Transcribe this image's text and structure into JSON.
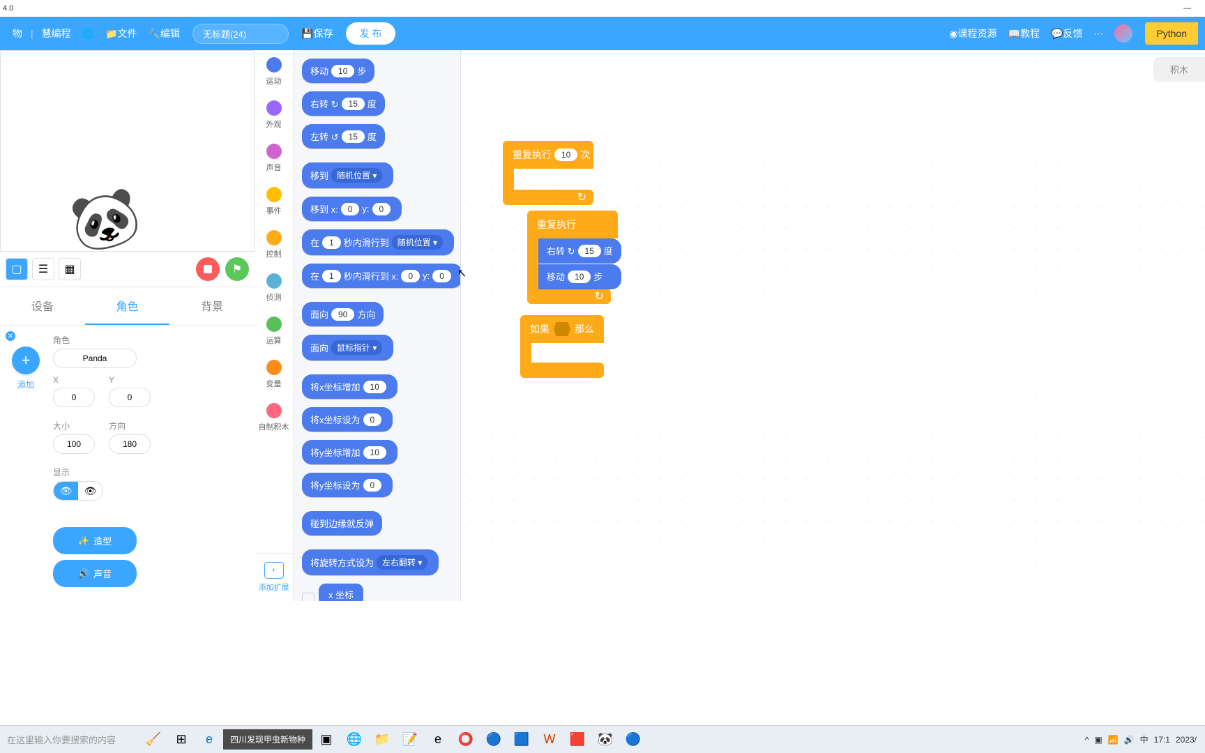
{
  "titlebar": {
    "version": "4.0"
  },
  "topbar": {
    "menu1": "物",
    "menu2": "慧编程",
    "file": "文件",
    "edit": "编辑",
    "project_name": "无标题(24)",
    "save": "保存",
    "publish": "发 布",
    "course": "课程资源",
    "tutorial": "教程",
    "feedback": "反馈",
    "python": "Python"
  },
  "stage_tabs": {
    "device": "设备",
    "sprite": "角色",
    "background": "背景"
  },
  "add": {
    "label": "添加"
  },
  "props": {
    "name_label": "角色",
    "name_value": "Panda",
    "x_label": "X",
    "x_value": "0",
    "y_label": "Y",
    "y_value": "0",
    "size_label": "大小",
    "size_value": "100",
    "dir_label": "方向",
    "dir_value": "180",
    "show_label": "显示",
    "costume_btn": "造型",
    "sound_btn": "声音"
  },
  "categories": [
    {
      "label": "运动",
      "color": "#4b7bec"
    },
    {
      "label": "外观",
      "color": "#9966ff"
    },
    {
      "label": "声音",
      "color": "#cf63cf"
    },
    {
      "label": "事件",
      "color": "#ffbf00"
    },
    {
      "label": "控制",
      "color": "#ffab19"
    },
    {
      "label": "侦测",
      "color": "#5cb1d6"
    },
    {
      "label": "运算",
      "color": "#59c059"
    },
    {
      "label": "变量",
      "color": "#ff8c1a"
    },
    {
      "label": "自制积木",
      "color": "#ff6680"
    }
  ],
  "ext": {
    "label": "添加扩展"
  },
  "blocks": {
    "move": {
      "t1": "移动",
      "v": "10",
      "t2": "步"
    },
    "turn_r": {
      "t1": "右转 ↻",
      "v": "15",
      "t2": "度"
    },
    "turn_l": {
      "t1": "左转 ↺",
      "v": "15",
      "t2": "度"
    },
    "goto_random": {
      "t1": "移到",
      "dd": "随机位置 ▾"
    },
    "goto_xy": {
      "t1": "移到 x:",
      "v1": "0",
      "t2": "y:",
      "v2": "0"
    },
    "glide_random": {
      "t1": "在",
      "v": "1",
      "t2": "秒内滑行到",
      "dd": "随机位置 ▾"
    },
    "glide_xy": {
      "t1": "在",
      "v": "1",
      "t2": "秒内滑行到 x:",
      "v2": "0",
      "t3": "y:",
      "v3": "0"
    },
    "point_dir": {
      "t1": "面向",
      "v": "90",
      "t2": "方向"
    },
    "point_mouse": {
      "t1": "面向",
      "dd": "鼠标指针 ▾"
    },
    "change_x": {
      "t1": "将x坐标增加",
      "v": "10"
    },
    "set_x": {
      "t1": "将x坐标设为",
      "v": "0"
    },
    "change_y": {
      "t1": "将y坐标增加",
      "v": "10"
    },
    "set_y": {
      "t1": "将y坐标设为",
      "v": "0"
    },
    "edge_bounce": {
      "t1": "碰到边缘就反弹"
    },
    "rotation_style": {
      "t1": "将旋转方式设为",
      "dd": "左右翻转 ▾"
    },
    "x_pos": {
      "t1": "x 坐标"
    }
  },
  "workspace": {
    "tab": "积木",
    "repeat_n": {
      "t1": "重复执行",
      "v": "10",
      "t2": "次"
    },
    "forever": {
      "t1": "重复执行"
    },
    "inner_turn": {
      "t1": "右转 ↻",
      "v": "15",
      "t2": "度"
    },
    "inner_move": {
      "t1": "移动",
      "v": "10",
      "t2": "步"
    },
    "if": {
      "t1": "如果",
      "t2": "那么"
    }
  },
  "taskbar": {
    "search": "在这里输入你要搜索的内容",
    "news": "四川发现甲虫新物种",
    "ime": "中",
    "time": "17:1",
    "date": "2023/"
  }
}
